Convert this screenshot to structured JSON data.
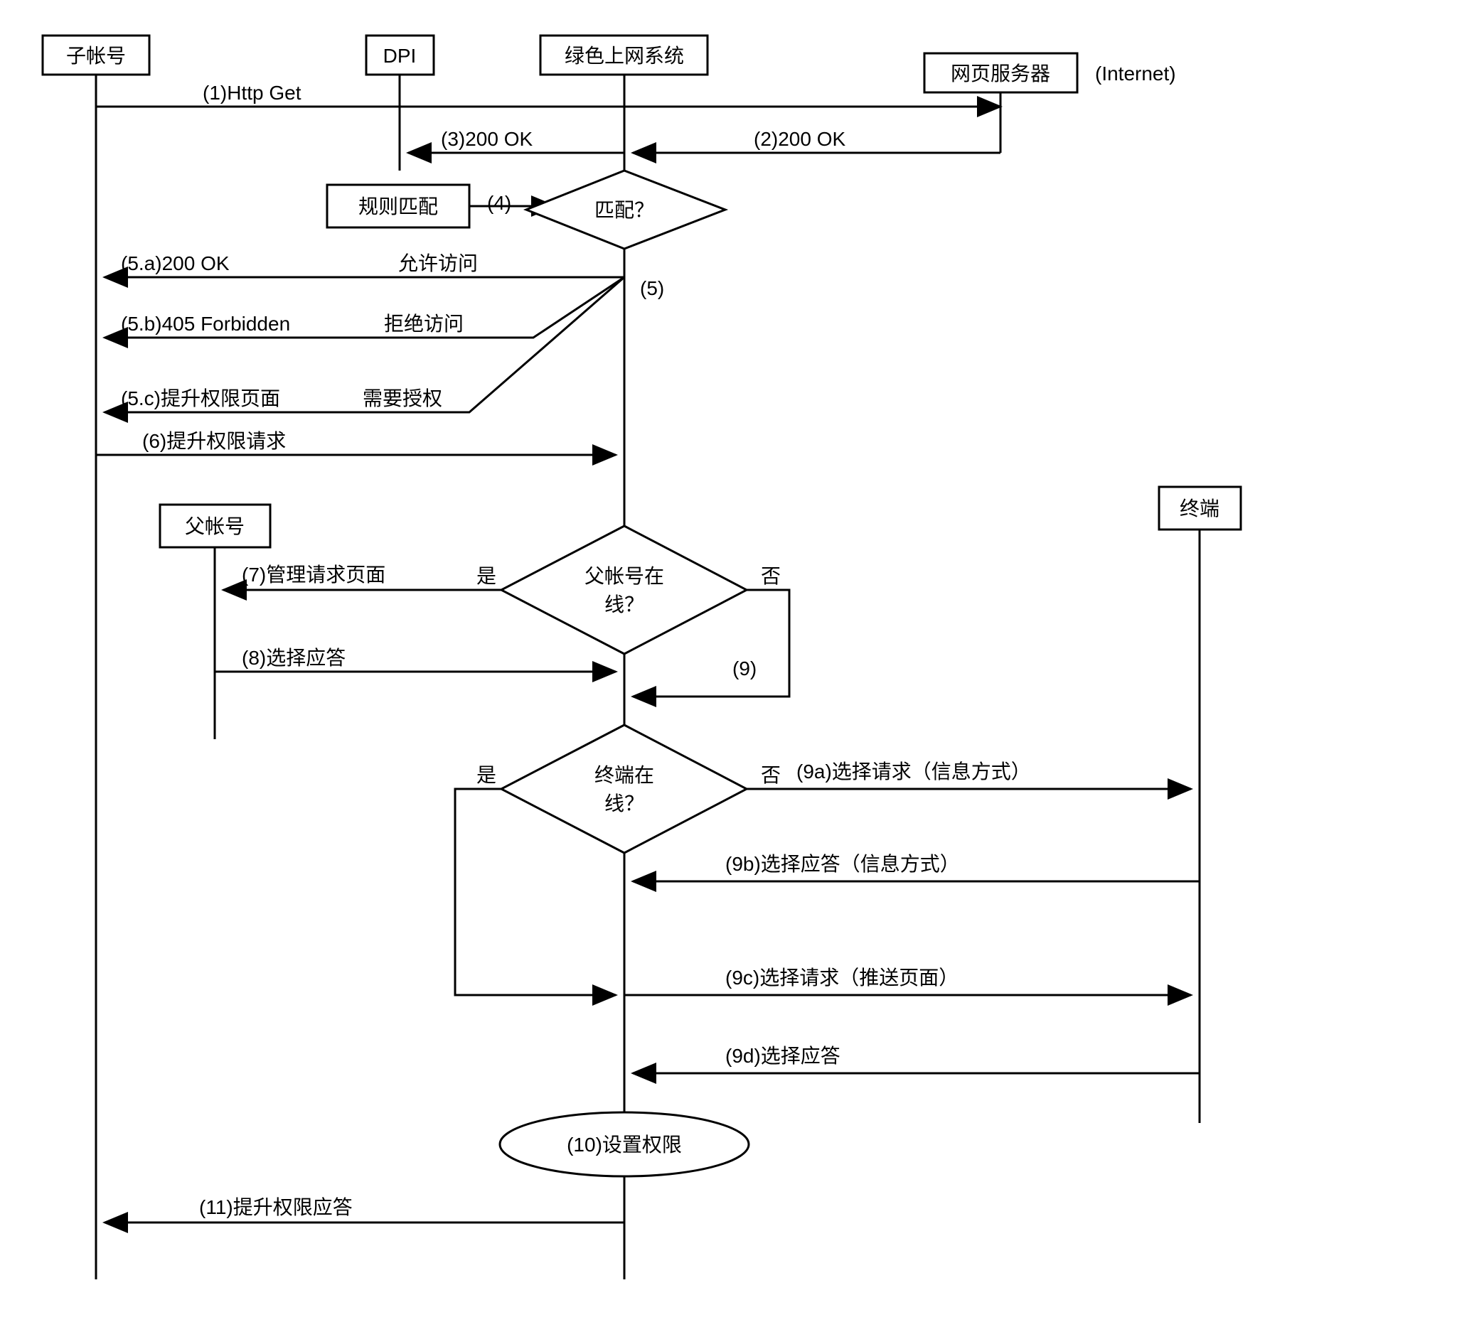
{
  "actors": {
    "child": "子帐号",
    "dpi": "DPI",
    "green": "绿色上网系统",
    "web": "网页服务器",
    "internet": "(Internet)",
    "parent": "父帐号",
    "terminal": "终端"
  },
  "steps": {
    "s1": "(1)Http Get",
    "s2": "(2)200 OK",
    "s3": "(3)200 OK",
    "rule_match": "规则匹配",
    "s4": "(4)",
    "match_q": "匹配？",
    "allow": "允许访问",
    "deny": "拒绝访问",
    "need_auth": "需要授权",
    "s5": "(5)",
    "s5a": "(5.a)200 OK",
    "s5b": "(5.b)405 Forbidden",
    "s5c": "(5.c)提升权限页面",
    "s6": "(6)提升权限请求",
    "s7": "(7)管理请求页面",
    "parent_online_q1": "父帐号在",
    "parent_online_q2": "线？",
    "yes": "是",
    "no": "否",
    "s8": "(8)选择应答",
    "s9": "(9)",
    "terminal_online_q1": "终端在",
    "terminal_online_q2": "线？",
    "s9a": "(9a)选择请求（信息方式）",
    "s9b": "(9b)选择应答（信息方式）",
    "s9c": "(9c)选择请求（推送页面）",
    "s9d": "(9d)选择应答",
    "s10": "(10)设置权限",
    "s11": "(11)提升权限应答"
  }
}
